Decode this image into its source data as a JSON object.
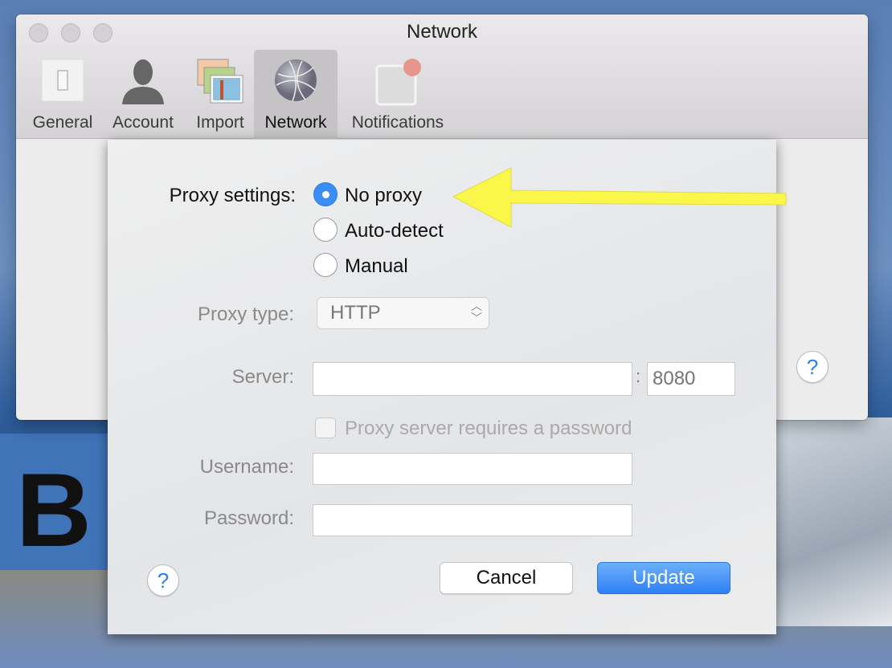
{
  "window": {
    "title": "Network"
  },
  "toolbar": {
    "items": [
      {
        "label": "General",
        "icon": "switch-icon"
      },
      {
        "label": "Account",
        "icon": "person-icon"
      },
      {
        "label": "Import",
        "icon": "photos-icon"
      },
      {
        "label": "Network",
        "icon": "globe-icon",
        "selected": true
      },
      {
        "label": "Notifications",
        "icon": "notification-badge-icon"
      }
    ]
  },
  "sheet": {
    "proxy_settings_label": "Proxy settings:",
    "options": [
      {
        "label": "No proxy",
        "selected": true
      },
      {
        "label": "Auto-detect",
        "selected": false
      },
      {
        "label": "Manual",
        "selected": false
      }
    ],
    "proxy_type_label": "Proxy type:",
    "proxy_type_value": "HTTP",
    "server_label": "Server:",
    "server_value": "",
    "port_separator": ":",
    "port_placeholder": "8080",
    "requires_password_label": "Proxy server requires a password",
    "requires_password_checked": false,
    "username_label": "Username:",
    "password_label": "Password:",
    "help_label": "?",
    "cancel_label": "Cancel",
    "update_label": "Update"
  },
  "window_help_label": "?",
  "colors": {
    "accent": "#3b8ef7",
    "annotation_arrow": "#fbf64a",
    "badge": "#e8958f"
  }
}
